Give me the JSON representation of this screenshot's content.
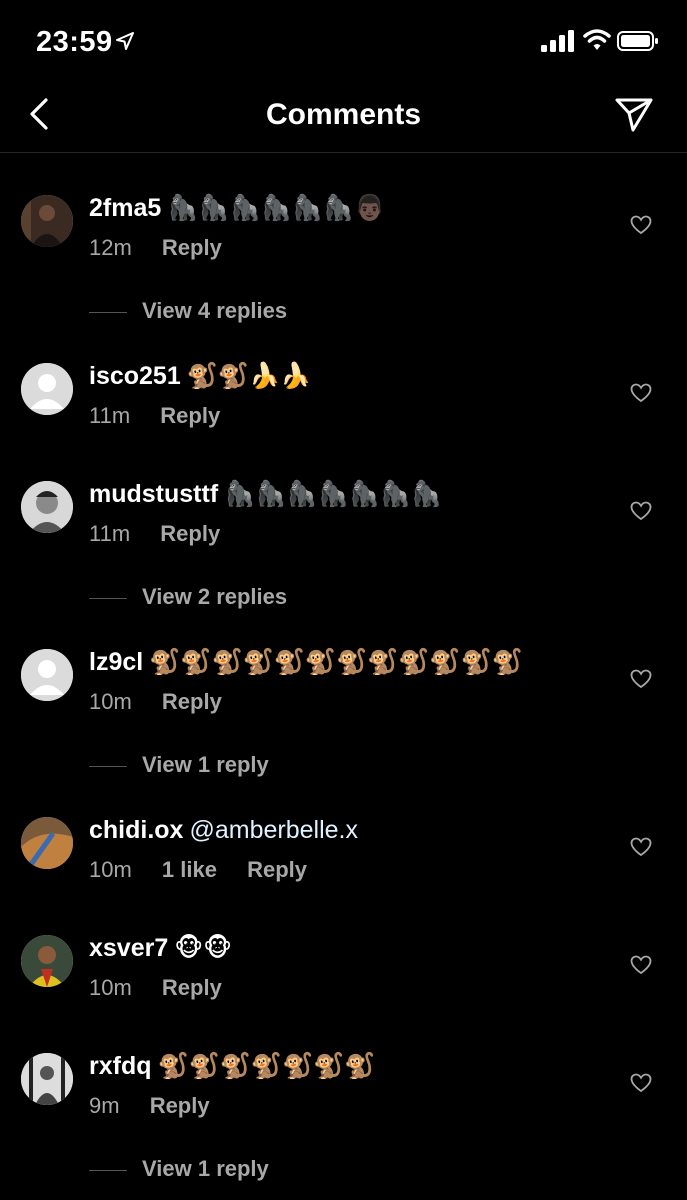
{
  "status_bar": {
    "time": "23:59"
  },
  "header": {
    "title": "Comments"
  },
  "comments": [
    {
      "username": "2fma5",
      "text": "🦍🦍🦍🦍🦍🦍👨🏿",
      "time": "12m",
      "reply_label": "Reply",
      "view_replies": "View 4 replies"
    },
    {
      "username": "isco251",
      "text": "🐒🐒🍌🍌",
      "time": "11m",
      "reply_label": "Reply"
    },
    {
      "username": "mudstusttf",
      "text": "🦍🦍🦍🦍🦍🦍🦍",
      "time": "11m",
      "reply_label": "Reply",
      "view_replies": "View 2 replies"
    },
    {
      "username": "lz9cl",
      "text": "🐒🐒🐒🐒🐒🐒🐒🐒🐒🐒🐒🐒",
      "time": "10m",
      "reply_label": "Reply",
      "view_replies": "View 1 reply"
    },
    {
      "username": "chidi.ox",
      "mention": "@amberbelle.x",
      "time": "10m",
      "likes": "1 like",
      "reply_label": "Reply"
    },
    {
      "username": "xsver7",
      "text": "🐵🐵",
      "time": "10m",
      "reply_label": "Reply"
    },
    {
      "username": "rxfdq",
      "text": "🐒🐒🐒🐒🐒🐒🐒",
      "time": "9m",
      "reply_label": "Reply",
      "view_replies": "View 1 reply"
    }
  ],
  "icons": {
    "back": "chevron-left-icon",
    "share": "paper-plane-icon",
    "like": "heart-icon"
  },
  "colors": {
    "background": "#000000",
    "text": "#ffffff",
    "secondary": "#a8a8a8"
  }
}
